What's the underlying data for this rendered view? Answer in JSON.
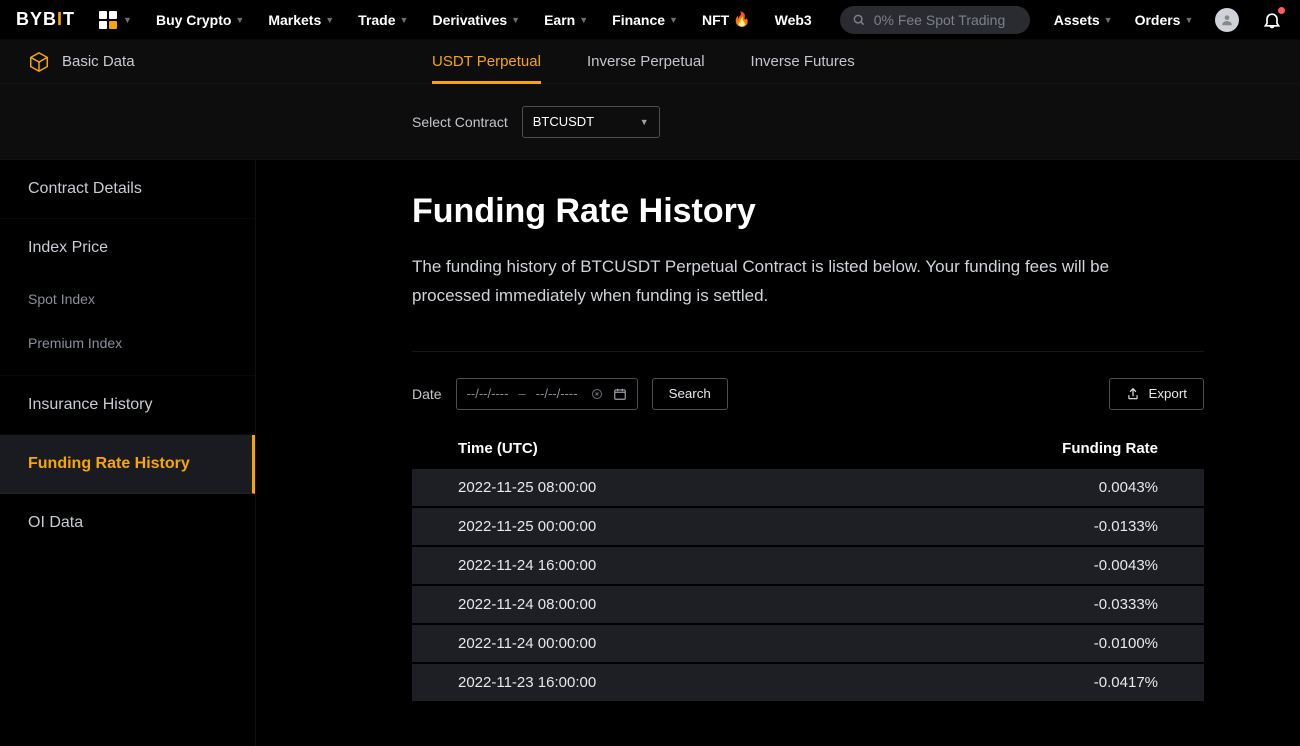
{
  "topnav": {
    "logo_parts": [
      "BYB",
      "I",
      "T"
    ],
    "items": [
      "Buy Crypto",
      "Markets",
      "Trade",
      "Derivatives",
      "Earn",
      "Finance"
    ],
    "nft_label": "NFT",
    "web3_label": "Web3",
    "search_placeholder": "0% Fee Spot Trading",
    "assets_label": "Assets",
    "orders_label": "Orders"
  },
  "subnav": {
    "basic_data_label": "Basic Data",
    "tabs": [
      "USDT Perpetual",
      "Inverse Perpetual",
      "Inverse Futures"
    ],
    "active_tab_index": 0
  },
  "contract": {
    "label": "Select Contract",
    "value": "BTCUSDT"
  },
  "sidebar": {
    "items": [
      {
        "label": "Contract Details",
        "type": "head"
      },
      {
        "label": "Index Price",
        "type": "head"
      },
      {
        "label": "Spot Index",
        "type": "sub"
      },
      {
        "label": "Premium Index",
        "type": "sub"
      },
      {
        "label": "Insurance History",
        "type": "head"
      },
      {
        "label": "Funding Rate History",
        "type": "head",
        "active": true
      },
      {
        "label": "OI Data",
        "type": "head"
      }
    ]
  },
  "main": {
    "title": "Funding Rate History",
    "description": "The funding history of BTCUSDT Perpetual Contract is listed below. Your funding fees will be processed immediately when funding is settled.",
    "date_label": "Date",
    "date_placeholder_from": "--/--/----",
    "date_placeholder_to": "--/--/----",
    "search_label": "Search",
    "export_label": "Export",
    "columns": {
      "time": "Time (UTC)",
      "rate": "Funding Rate"
    },
    "rows": [
      {
        "time": "2022-11-25 08:00:00",
        "rate": "0.0043%"
      },
      {
        "time": "2022-11-25 00:00:00",
        "rate": "-0.0133%"
      },
      {
        "time": "2022-11-24 16:00:00",
        "rate": "-0.0043%"
      },
      {
        "time": "2022-11-24 08:00:00",
        "rate": "-0.0333%"
      },
      {
        "time": "2022-11-24 00:00:00",
        "rate": "-0.0100%"
      },
      {
        "time": "2022-11-23 16:00:00",
        "rate": "-0.0417%"
      }
    ]
  }
}
